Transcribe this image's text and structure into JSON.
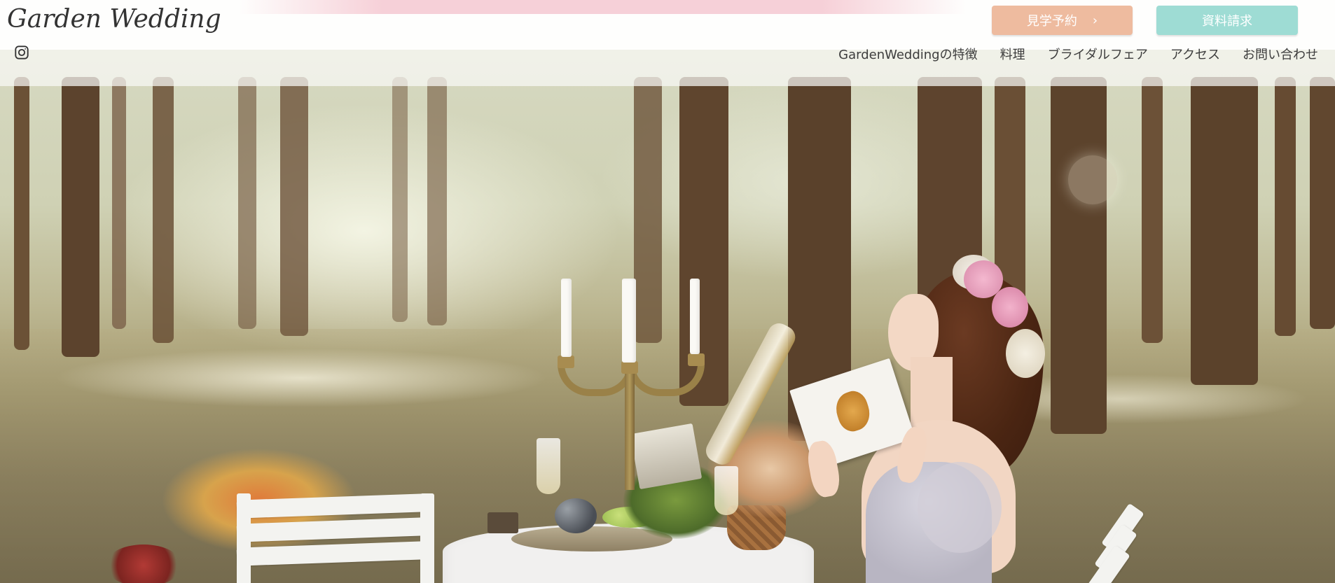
{
  "header": {
    "logo": "Garden Wedding",
    "social_icon": "instagram-icon",
    "cta": {
      "visit_label": "見学予約",
      "visit_icon": "chevron-right-icon",
      "visit_color": "#eebb9f",
      "docs_label": "資料請求",
      "docs_color": "#9edcd4"
    }
  },
  "nav": {
    "items": [
      {
        "label": "GardenWeddingの特徴"
      },
      {
        "label": "料理"
      },
      {
        "label": "ブライダルフェア"
      },
      {
        "label": "アクセス"
      },
      {
        "label": "お問い合わせ"
      }
    ]
  }
}
